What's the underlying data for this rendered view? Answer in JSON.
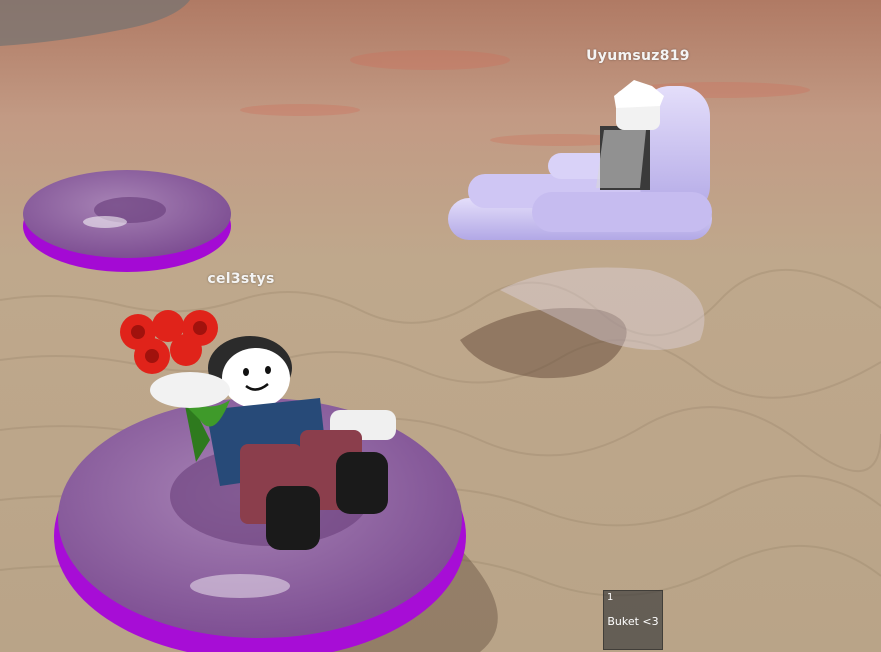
{
  "players": [
    {
      "name": "Uyumsuz819"
    },
    {
      "name": "cel3stys"
    }
  ],
  "hotbar": {
    "slots": [
      {
        "number": "1",
        "label": "Buket <3"
      }
    ]
  },
  "colors": {
    "water": "#b8a58a",
    "float_ring": "#a000d0",
    "float_lounge": "#c8c0f0",
    "roses": "#e0231a",
    "nametag": "#f4f4f4"
  },
  "icons": {
    "tool": "bouquet-tool"
  }
}
